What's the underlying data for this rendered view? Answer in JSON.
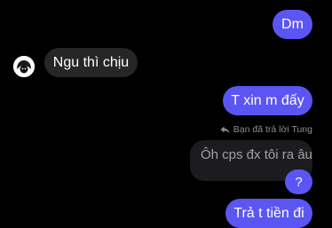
{
  "conversation": {
    "messages": [
      {
        "text": "Dm",
        "sender": "me"
      },
      {
        "text": "Ngu thì chịu",
        "sender": "other"
      },
      {
        "text": "T xin m đấy",
        "sender": "me"
      },
      {
        "reply_label": "Bạn đã trả lời Tung",
        "quoted_text": "Ôh cps đx tôi ra âu"
      },
      {
        "text": "?",
        "sender": "me"
      },
      {
        "text": "Trả t tiền đi",
        "sender": "me"
      }
    ],
    "colors": {
      "sent_bubble": "#5b55f3",
      "received_bubble": "#262626",
      "quote_bubble": "#1c1c1e",
      "background": "#000000"
    },
    "icons": {
      "reply": "reply-arrow-icon",
      "avatar": "avatar"
    }
  }
}
